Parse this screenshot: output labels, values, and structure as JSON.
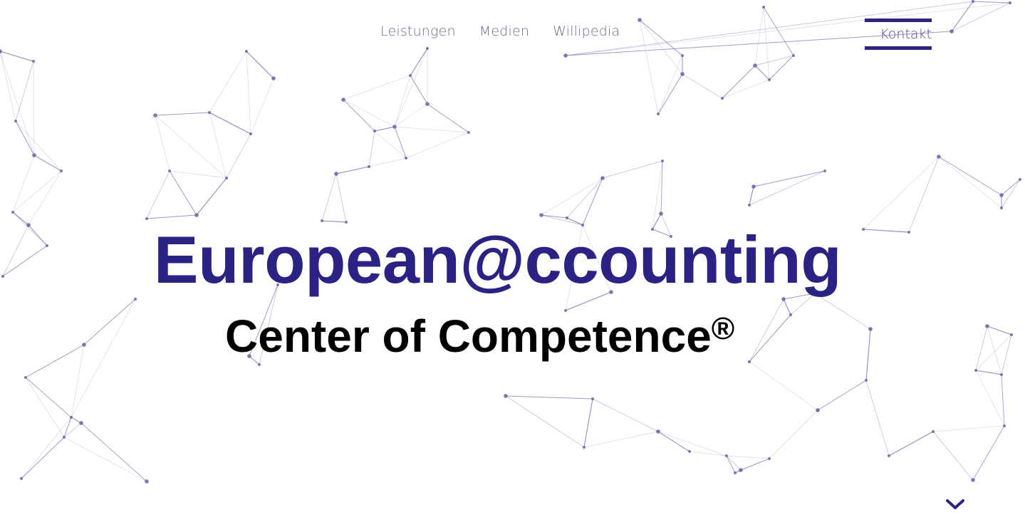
{
  "nav": {
    "items": [
      {
        "label": "Leistungen"
      },
      {
        "label": "Medien"
      },
      {
        "label": "Willipedia"
      }
    ],
    "contact_label": "Kontakt"
  },
  "hero": {
    "title": "European@ccounting",
    "subtitle": "Center of Competence",
    "subtitle_mark": "®"
  },
  "icons": {
    "scroll": "chevron-down-icon"
  },
  "colors": {
    "brand": "#2a2383",
    "accent": "#2c2680",
    "nav_text": "#6a6a94",
    "network_line": "#8a86c0",
    "network_dot": "#6d6aa8"
  }
}
